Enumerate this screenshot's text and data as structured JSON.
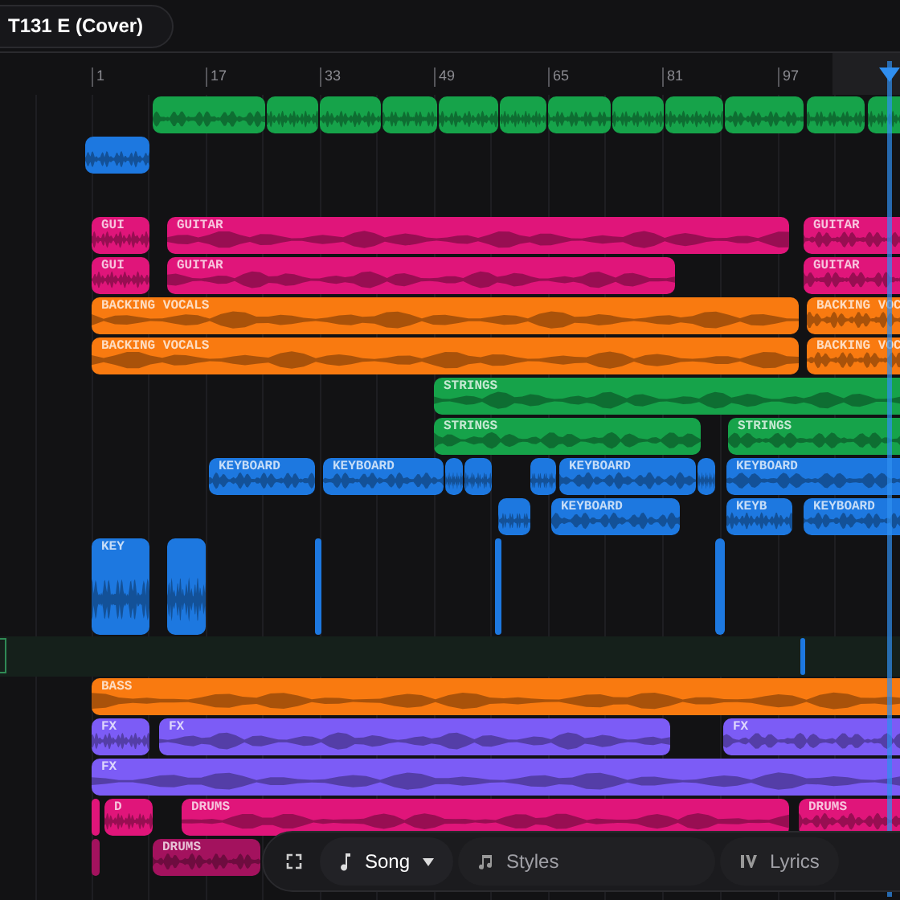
{
  "title": "T131 E (Cover)",
  "ruler": [
    "1",
    "17",
    "33",
    "49",
    "65",
    "81",
    "97"
  ],
  "tracks": [
    {
      "color": "#16a34a",
      "selected": false,
      "clips": [
        {
          "kind": "clip"
        },
        {
          "kind": "clip"
        },
        {
          "kind": "clip"
        },
        {
          "kind": "clip"
        },
        {
          "kind": "clip"
        },
        {
          "kind": "clip"
        },
        {
          "kind": "clip"
        },
        {
          "kind": "clip"
        },
        {
          "kind": "clip"
        },
        {
          "kind": "clip"
        },
        {
          "kind": "clip"
        },
        {
          "kind": "clip"
        }
      ]
    },
    {
      "color": "#1d78e0",
      "selected": false,
      "clips": [
        {
          "kind": "clip"
        }
      ]
    },
    {
      "selected": false
    },
    {
      "color": "#e0157a",
      "selected": false,
      "clips": [
        {
          "kind": "clip",
          "label": "GUI"
        },
        {
          "kind": "clip",
          "label": "GUITAR"
        },
        {
          "kind": "clip",
          "label": "GUITAR"
        }
      ]
    },
    {
      "color": "#e0157a",
      "selected": false,
      "clips": [
        {
          "kind": "clip",
          "label": "GUI"
        },
        {
          "kind": "clip",
          "label": "GUITAR"
        },
        {
          "kind": "clip",
          "label": "GUITAR"
        }
      ]
    },
    {
      "color": "#f97a10",
      "selected": false,
      "clips": [
        {
          "kind": "clip",
          "label": "BACKING VOCALS"
        },
        {
          "kind": "clip",
          "label": "BACKING VOC"
        }
      ]
    },
    {
      "color": "#f97a10",
      "selected": false,
      "clips": [
        {
          "kind": "clip",
          "label": "BACKING VOCALS"
        },
        {
          "kind": "clip",
          "label": "BACKING VOC"
        }
      ]
    },
    {
      "color": "#16a34a",
      "selected": false,
      "clips": [
        {
          "kind": "clip",
          "label": "STRINGS"
        }
      ]
    },
    {
      "color": "#16a34a",
      "selected": false,
      "clips": [
        {
          "kind": "clip",
          "label": "STRINGS"
        },
        {
          "kind": "clip",
          "label": "STRINGS"
        }
      ]
    },
    {
      "color": "#1d78e0",
      "selected": false,
      "clips": [
        {
          "kind": "clip",
          "label": "KEYBOARD"
        },
        {
          "kind": "clip",
          "label": "KEYBOARD"
        },
        {
          "kind": "clip"
        },
        {
          "kind": "clip"
        },
        {
          "kind": "clip"
        },
        {
          "kind": "clip",
          "label": "KEYBOARD"
        },
        {
          "kind": "clip"
        },
        {
          "kind": "clip",
          "label": "KEYBOARD"
        }
      ]
    },
    {
      "color": "#1d78e0",
      "selected": false,
      "clips": [
        {
          "kind": "clip"
        },
        {
          "kind": "clip",
          "label": "KEYBOARD"
        },
        {
          "kind": "clip",
          "label": "KEYB"
        },
        {
          "kind": "clip",
          "label": "KEYBOARD"
        }
      ]
    },
    {
      "color": "#1d78e0",
      "selected": false,
      "clips": [
        {
          "kind": "clip",
          "label": "KEY"
        },
        {
          "kind": "clip"
        },
        {
          "kind": "clip"
        },
        {
          "kind": "clip"
        },
        {
          "kind": "clip"
        }
      ]
    },
    {
      "color": "#1d78e0",
      "selected": true,
      "clips": [
        {
          "kind": "clip"
        }
      ]
    },
    {
      "color": "#f97a10",
      "selected": false,
      "clips": [
        {
          "kind": "clip",
          "label": "BASS"
        }
      ]
    },
    {
      "color": "#7c5cf6",
      "selected": false,
      "clips": [
        {
          "kind": "clip",
          "label": "FX"
        },
        {
          "kind": "clip",
          "label": "FX"
        },
        {
          "kind": "clip",
          "label": "FX"
        }
      ]
    },
    {
      "color": "#7c5cf6",
      "selected": false,
      "clips": [
        {
          "kind": "clip",
          "label": "FX"
        }
      ]
    },
    {
      "color": "#e0157a",
      "selected": false,
      "clips": [
        {
          "kind": "clip"
        },
        {
          "kind": "clip",
          "label": "D"
        },
        {
          "kind": "clip",
          "label": "DRUMS"
        },
        {
          "kind": "clip",
          "label": "DRUMS"
        }
      ]
    },
    {
      "color": "#a3125e",
      "selected": false,
      "clips": [
        {
          "kind": "clip"
        },
        {
          "kind": "clip",
          "label": "DRUMS"
        }
      ]
    }
  ],
  "toolbar": {
    "tabs": [
      {
        "label": "Song",
        "selected": true,
        "kind": "menu"
      },
      {
        "label": "Styles",
        "selected": false,
        "kind": "styles"
      },
      {
        "label": "Lyrics",
        "selected": false,
        "kind": "lyrics"
      }
    ]
  }
}
